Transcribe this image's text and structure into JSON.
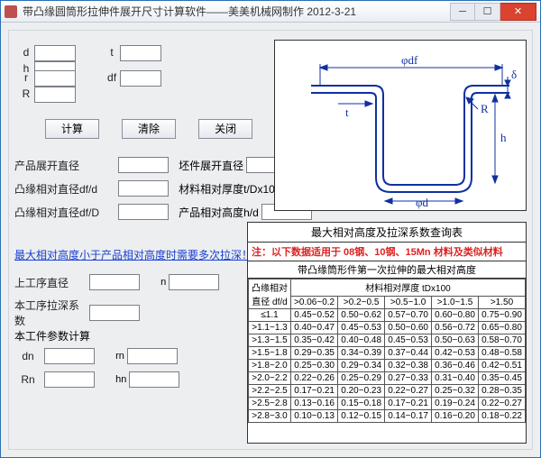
{
  "window": {
    "title": "带凸缘圆筒形拉伸件展开尺寸计算软件——美美机械网制作  2012-3-21"
  },
  "inputs": {
    "d": "d",
    "t": "t",
    "h": "h",
    "r": "r",
    "df": "df",
    "R": "R"
  },
  "buttons": {
    "calc": "计算",
    "clear": "清除",
    "close": "关闭"
  },
  "outputs": {
    "prod_dia": "产品展开直径",
    "blank_dia": "坯件展开直径",
    "flange_dfd": "凸缘相对直径df/d",
    "mat_tDx100": "材料相对厚度t/Dx100",
    "flange_dfD": "凸缘相对直径df/D",
    "prod_hd": "产品相对高度h/d"
  },
  "warn": "最大相对高度小于产品相对高度时需要多次拉深！",
  "sub1": {
    "prev_dia": "上工序直径",
    "n": "n",
    "coef": "本工序拉深系数"
  },
  "sub_header": "本工件参数计算",
  "sub2": {
    "dn": "dn",
    "rn": "rn",
    "Rn": "Rn",
    "hn": "hn"
  },
  "diagram": {
    "df": "φdf",
    "delta": "δ",
    "t": "t",
    "R": "R",
    "h": "h",
    "d": "φd"
  },
  "table": {
    "title": "最大相对高度及拉深系数查询表",
    "note_pre": "注：以下数据适用于",
    "note_mats": " 08钢、10钢、15Mn 材料及类似材料",
    "sub": "带凸缘筒形件第一次拉伸的最大相对高度",
    "rowhdr_top": "凸缘相对",
    "rowhdr_bot": "直径 df/d",
    "colhdr": "材料相对厚度 tDx100",
    "cols": [
      ">0.06~0.2",
      ">0.2~0.5",
      ">0.5~1.0",
      ">1.0~1.5",
      ">1.50"
    ],
    "rows": [
      {
        "k": "≤1.1",
        "v": [
          "0.45~0.52",
          "0.50~0.62",
          "0.57~0.70",
          "0.60~0.80",
          "0.75~0.90"
        ]
      },
      {
        "k": ">1.1~1.3",
        "v": [
          "0.40~0.47",
          "0.45~0.53",
          "0.50~0.60",
          "0.56~0.72",
          "0.65~0.80"
        ]
      },
      {
        "k": ">1.3~1.5",
        "v": [
          "0.35~0.42",
          "0.40~0.48",
          "0.45~0.53",
          "0.50~0.63",
          "0.58~0.70"
        ]
      },
      {
        "k": ">1.5~1.8",
        "v": [
          "0.29~0.35",
          "0.34~0.39",
          "0.37~0.44",
          "0.42~0.53",
          "0.48~0.58"
        ]
      },
      {
        "k": ">1.8~2.0",
        "v": [
          "0.25~0.30",
          "0.29~0.34",
          "0.32~0.38",
          "0.36~0.46",
          "0.42~0.51"
        ]
      },
      {
        "k": ">2.0~2.2",
        "v": [
          "0.22~0.26",
          "0.25~0.29",
          "0.27~0.33",
          "0.31~0.40",
          "0.35~0.45"
        ]
      },
      {
        "k": ">2.2~2.5",
        "v": [
          "0.17~0.21",
          "0.20~0.23",
          "0.22~0.27",
          "0.25~0.32",
          "0.28~0.35"
        ]
      },
      {
        "k": ">2.5~2.8",
        "v": [
          "0.13~0.16",
          "0.15~0.18",
          "0.17~0.21",
          "0.19~0.24",
          "0.22~0.27"
        ]
      },
      {
        "k": ">2.8~3.0",
        "v": [
          "0.10~0.13",
          "0.12~0.15",
          "0.14~0.17",
          "0.16~0.20",
          "0.18~0.22"
        ]
      }
    ]
  }
}
